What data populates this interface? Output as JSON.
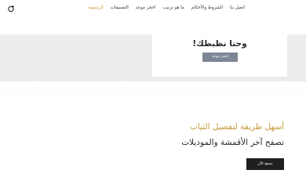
{
  "header": {
    "logo_icon": "logo-mark-icon",
    "nav": [
      {
        "label": "الرئيسية",
        "active": true
      },
      {
        "label": "التصنيفات",
        "active": false
      },
      {
        "label": "احجز موعد",
        "active": false
      },
      {
        "label": "ما هو ترتيب",
        "active": false
      },
      {
        "label": "الشروط والأحكام",
        "active": false
      },
      {
        "label": "اتصل بنا",
        "active": false
      }
    ],
    "active_color": "#c59b3c"
  },
  "promo": {
    "title": "وحنا نظبطك!",
    "button_label": "احجز موعد"
  },
  "intro": {
    "tagline": "أسهل طريقة لتفصيل الثياب",
    "subline": "تصفح آخر الأقمشة والموديلات",
    "button_label": "تصفح الآن"
  }
}
